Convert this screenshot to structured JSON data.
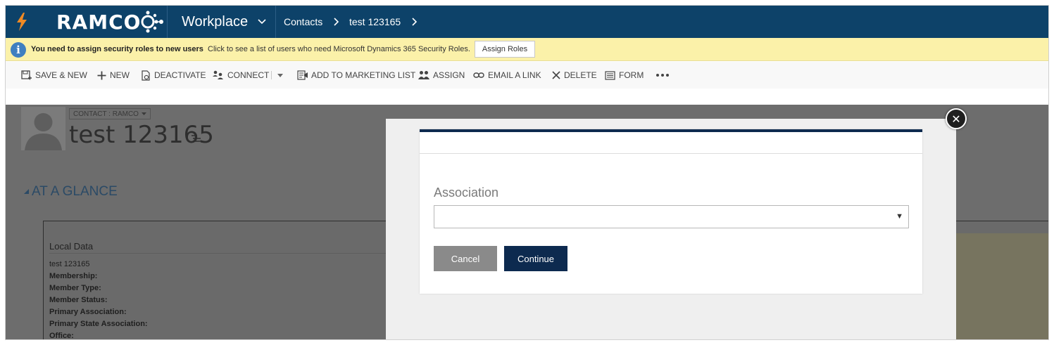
{
  "nav": {
    "logo_text": "RAMCO",
    "workplace": "Workplace",
    "breadcrumb": [
      "Contacts",
      "test 123165"
    ]
  },
  "notification": {
    "bold_text": "You need to assign security roles to new users",
    "text": "Click to see a list of users who need Microsoft Dynamics 365 Security Roles.",
    "button": "Assign Roles"
  },
  "commands": {
    "save_new": "SAVE & NEW",
    "new": "NEW",
    "deactivate": "DEACTIVATE",
    "connect": "CONNECT",
    "add_to_marketing_list": "ADD TO MARKETING LIST",
    "assign": "ASSIGN",
    "email_a_link": "EMAIL A LINK",
    "delete": "DELETE",
    "form": "FORM"
  },
  "record": {
    "entity_label": "CONTACT : RAMCO",
    "title": "test 123165",
    "section": "AT A GLANCE",
    "local_data_title": "Local Data",
    "local_name": "test 123165",
    "fields": [
      "Membership:",
      "Member Type:",
      "Member Status:",
      "Primary Association:",
      "Primary State Association:",
      "Office:"
    ]
  },
  "dialog": {
    "association_label": "Association",
    "association_value": "",
    "cancel": "Cancel",
    "continue": "Continue"
  },
  "colors": {
    "nav_bg": "#0d4269",
    "notify_bg": "#fbf1a9",
    "primary_button": "#0d2a4f",
    "bolt": "#f08a24"
  }
}
